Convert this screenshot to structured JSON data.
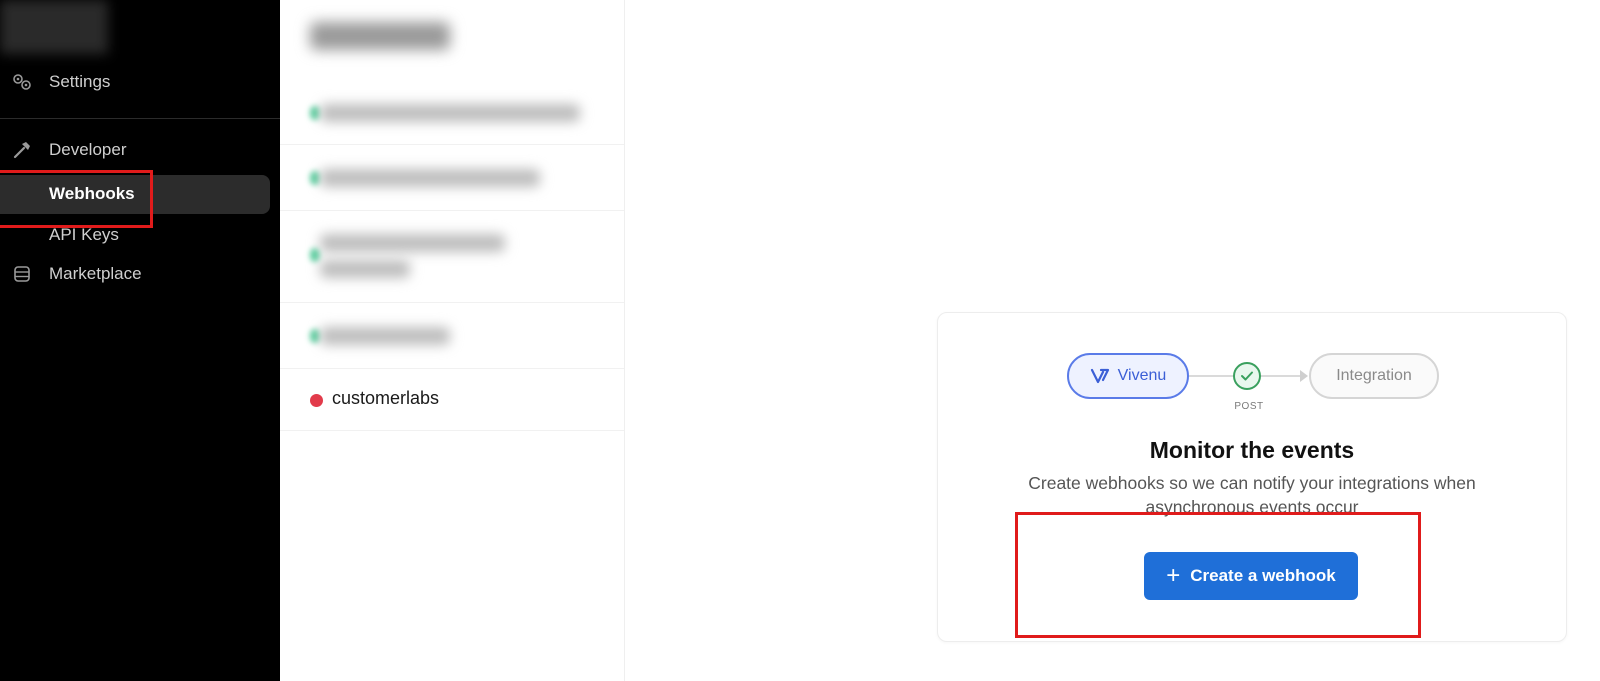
{
  "sidebar": {
    "items": [
      {
        "label": "Settings",
        "icon": "gears-icon"
      },
      {
        "label": "Developer",
        "icon": "hammer-icon"
      },
      {
        "label": "Webhooks",
        "active": true
      },
      {
        "label": "API Keys"
      },
      {
        "label": "Marketplace",
        "icon": "database-icon"
      }
    ]
  },
  "webhook_list": {
    "visible_item": {
      "label": "customerlabs",
      "status_color": "#e23b4b"
    }
  },
  "empty_state": {
    "flow": {
      "source": "Vivenu",
      "method": "POST",
      "target": "Integration"
    },
    "title": "Monitor the events",
    "description": "Create webhooks so we can notify your integrations when asynchronous events occur",
    "button_label": "Create a webhook",
    "button_icon": "plus-icon"
  },
  "colors": {
    "accent": "#1f6fd8",
    "annotation": "#e01b1b",
    "sidebar_bg": "#000000"
  }
}
